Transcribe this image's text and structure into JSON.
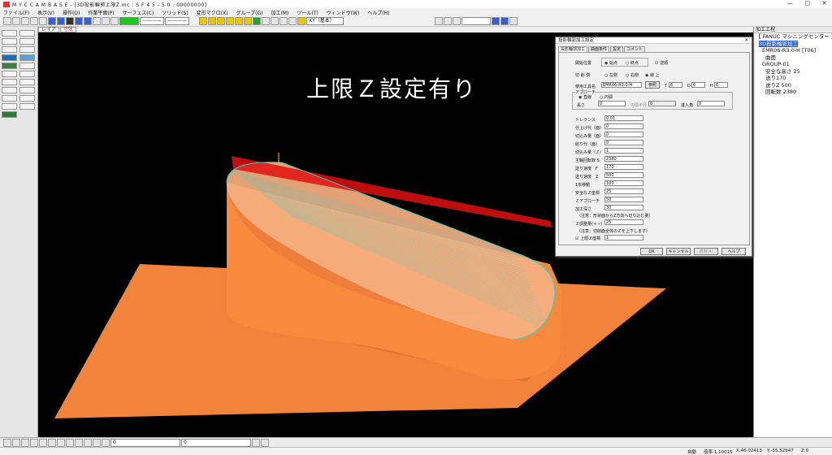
{
  "app": {
    "title": "M Y C   C A M B A S E  - [3D投影輪郭上限Z.mc : S F 4 5 - 5 0 : 00000000]"
  },
  "window": {
    "controls": [
      "—",
      "□",
      "✕"
    ]
  },
  "menu": [
    "ファイル(F)",
    "表示(V)",
    "操作(O)",
    "作業平面(P)",
    "サーフェス(C)",
    "ソリッド(S)",
    "変形マクロ(X)",
    "グループ(G)",
    "加工(M)",
    "ツール(T)",
    "ウィンドウ(W)",
    "ヘルプ(H)"
  ],
  "toolbar": {
    "view_combo": "XY（基本）",
    "line_combo_1": "————",
    "line_combo_2": "————"
  },
  "tabs": [
    {
      "label": "レイア"
    },
    {
      "label": "寸法"
    }
  ],
  "viewport": {
    "overlay_text": "上限Ｚ設定有り",
    "colors": {
      "background": "#000000",
      "plate": "#f2833a",
      "body": "#f88a3e",
      "cap": "#f6b080",
      "toolpath": "#e01010",
      "boundary": "#2fd0d0"
    }
  },
  "tree": {
    "header": "加工工程",
    "nodes": [
      {
        "text": "【 FANUC  マシニングセンター 】",
        "indent": 0,
        "selected": false
      },
      {
        "text": "3D投影輪郭加工",
        "indent": 1,
        "selected": true
      },
      {
        "text": "EMR06-R3.0-H [T06]",
        "indent": 1,
        "selected": false
      },
      {
        "text": "曲面",
        "indent": 1,
        "selected": false
      },
      {
        "text": "GROUP-01",
        "indent": 1,
        "selected": false
      },
      {
        "text": "安全な高さ 25",
        "indent": 1,
        "selected": false
      },
      {
        "text": "送り170",
        "indent": 1,
        "selected": false
      },
      {
        "text": "送りZ 500",
        "indent": 1,
        "selected": false
      },
      {
        "text": "回転数 2380",
        "indent": 1,
        "selected": false
      }
    ]
  },
  "dialog": {
    "title": "投影輪郭加工設定",
    "tabs": [
      {
        "label": "投影輪郭加工"
      },
      {
        "label": "曲面条件"
      },
      {
        "label": "設定"
      },
      {
        "label": "コメント"
      }
    ],
    "start_pos_label": "開始位置",
    "start_pos_options": [
      "始点",
      "終点"
    ],
    "reverse_label": "逆順",
    "cut_dir_label": "切 削 側",
    "cut_dir_options": [
      "左側",
      "右側",
      "線 上"
    ],
    "tool_label": "使用工具名",
    "tool_value": "EMR06-R3.0-H",
    "tool_btn": "参照",
    "t_label": "T",
    "t_value": "6",
    "d_label": "D",
    "d_value": "6",
    "h_label": "H",
    "h_value": "6",
    "approach_label": "アプローチ",
    "approach_options": [
      "直線",
      "円弧"
    ],
    "approach_len_label": "長さ",
    "approach_len": "0",
    "approach_radius_label": "円弧半径",
    "approach_radius": "0",
    "approach_angle_label": "進入角",
    "approach_angle": "0",
    "params": [
      {
        "label": "トレランス",
        "value": "0.01"
      },
      {
        "label": "仕上げ代（面）",
        "value": "0"
      },
      {
        "label": "切込み量（面）",
        "value": "0"
      },
      {
        "label": "削り代（面）",
        "value": "0"
      },
      {
        "label": "切込み量（Ｚ）",
        "value": "1"
      },
      {
        "label": "主軸回転数 S",
        "value": "2380"
      },
      {
        "label": "送り速度　F",
        "value": "170"
      },
      {
        "label": "送り速度　Z",
        "value": "500"
      },
      {
        "label": "1本移動",
        "value": "100"
      },
      {
        "label": "安全なＺ座標",
        "value": "25"
      },
      {
        "label": "Ｚアプローチ",
        "value": "50"
      },
      {
        "label": "加工深さ",
        "value": "30"
      }
    ],
    "note1": "（注意：形状面からZ方向へ切り込む量）",
    "offset_label": "Ｚ調整量(＋−)",
    "offset_value": "25",
    "note2": "（注意：切削面全体のＺを上下します）",
    "upper_z_label": "上限Ｚ座標",
    "upper_z_value": "1",
    "buttons": {
      "ok": "OK",
      "cancel": "キャンセル",
      "apply": "適用(A)",
      "help": "ヘルプ"
    }
  },
  "bottombar": {
    "layer_1": "0",
    "layer_2": "0"
  },
  "status": {
    "mode": "自動",
    "scale": "倍率:1.10015",
    "x": "X:46.02413",
    "y": "Y:-55.52947",
    "z": "Z:0"
  }
}
